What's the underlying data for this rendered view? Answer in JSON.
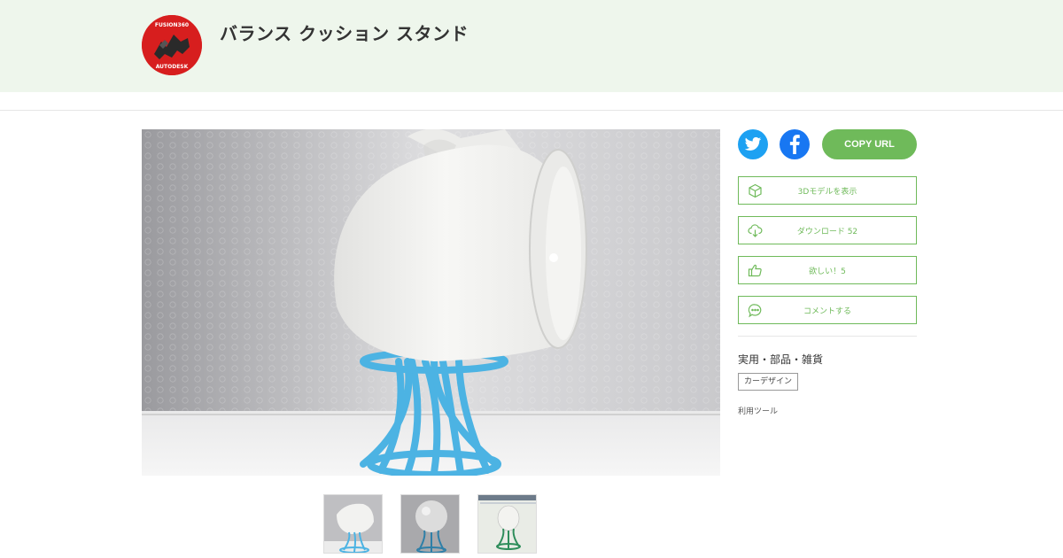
{
  "header": {
    "title": "バランス クッション スタンド",
    "avatar": {
      "top_text": "FUSION360",
      "bottom_text": "AUTODESK"
    }
  },
  "share": {
    "twitter_icon": "twitter-icon",
    "facebook_icon": "facebook-icon",
    "copy_url_label": "COPY URL"
  },
  "actions": {
    "view_3d_label": "3Dモデルを表示",
    "download_label": "ダウンロード 52",
    "want_label": "欲しい！5",
    "comment_label": "コメントする"
  },
  "sidebar": {
    "category": "実用・部品・雑貨",
    "tag": "カーデザイン",
    "tools_label": "利用ツール"
  },
  "colors": {
    "header_bg": "#eef6ec",
    "accent_green": "#6fba5a",
    "twitter_blue": "#1da1f2",
    "facebook_blue": "#1877f2",
    "stand_blue": "#4cb3e3"
  }
}
